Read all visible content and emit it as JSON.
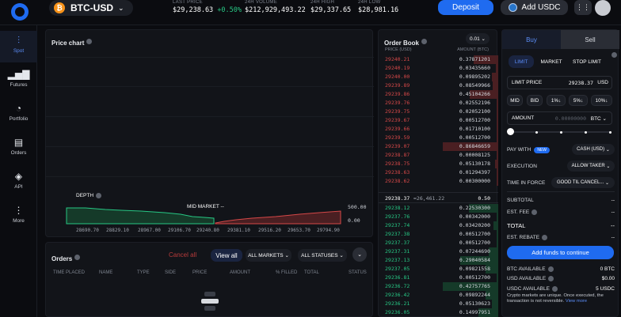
{
  "header": {
    "pair": "BTC-USD",
    "stats": [
      {
        "label": "LAST PRICE",
        "value": "$29,238.63",
        "change": "+0.50%"
      },
      {
        "label": "24H VOLUME",
        "value": "$212,929,493.22"
      },
      {
        "label": "24H HIGH",
        "value": "$29,337.65"
      },
      {
        "label": "24H LOW",
        "value": "$28,981.16"
      }
    ],
    "deposit": "Deposit",
    "add_usdc": "Add USDC"
  },
  "sidebar": [
    {
      "label": "Spot",
      "icon": "chart-icon"
    },
    {
      "label": "Futures",
      "icon": "bar-chart-icon"
    },
    {
      "label": "Portfolio",
      "icon": "pie-chart-icon"
    },
    {
      "label": "Orders",
      "icon": "document-icon"
    },
    {
      "label": "API",
      "icon": "layers-icon"
    },
    {
      "label": "More",
      "icon": "more-icon"
    }
  ],
  "chart": {
    "title": "Price chart",
    "depth_label": "DEPTH",
    "mid_label": "MID MARKET --",
    "y_top": "500.00",
    "y_bottom": "0.00",
    "x_ticks": [
      "28690.70",
      "28829.10",
      "28967.00",
      "29106.70",
      "29240.80",
      "29381.10",
      "29516.20",
      "29653.70",
      "29794.90"
    ]
  },
  "orders": {
    "title": "Orders",
    "cancel_all": "Cancel all",
    "view_all": "View all",
    "markets": "ALL MARKETS",
    "statuses": "ALL STATUSES",
    "columns": [
      "TIME PLACED",
      "NAME",
      "TYPE",
      "SIDE",
      "PRICE",
      "AMOUNT",
      "% FILLED",
      "TOTAL",
      "STATUS"
    ]
  },
  "orderbook": {
    "title": "Order Book",
    "increment": "0.01",
    "col_price": "PRICE (USD)",
    "col_amount": "AMOUNT (BTC)",
    "asks": [
      [
        "29240.21",
        "0.37871201"
      ],
      [
        "29240.19",
        "0.03435660"
      ],
      [
        "29240.00",
        "0.09895202"
      ],
      [
        "29239.89",
        "0.08549966"
      ],
      [
        "29239.86",
        "0.45104266"
      ],
      [
        "29239.76",
        "0.02552196"
      ],
      [
        "29239.75",
        "0.02052100"
      ],
      [
        "29239.67",
        "0.00512700"
      ],
      [
        "29239.66",
        "0.01710100"
      ],
      [
        "29239.59",
        "0.00512700"
      ],
      [
        "29239.07",
        "0.86846659"
      ],
      [
        "29238.87",
        "0.00008125"
      ],
      [
        "29238.75",
        "0.05130178"
      ],
      [
        "29238.63",
        "0.01294397"
      ],
      [
        "29238.62",
        "0.00300000"
      ]
    ],
    "spread_price": "29238.37",
    "spread_usd": "≈26,461.22",
    "spread_val": "0.50",
    "bids": [
      [
        "29238.12",
        "0.22530300"
      ],
      [
        "29237.76",
        "0.00342000"
      ],
      [
        "29237.74",
        "0.03420200"
      ],
      [
        "29237.38",
        "0.00512700"
      ],
      [
        "29237.37",
        "0.00512700"
      ],
      [
        "29237.31",
        "0.07244690"
      ],
      [
        "29237.13",
        "0.29040584"
      ],
      [
        "29237.05",
        "0.09821558"
      ],
      [
        "29236.81",
        "0.00512700"
      ],
      [
        "29236.72",
        "0.42757765"
      ],
      [
        "29236.42",
        "0.09892244"
      ],
      [
        "29236.21",
        "0.05130623"
      ],
      [
        "29236.05",
        "0.14997951"
      ]
    ]
  },
  "trade": {
    "buy": "Buy",
    "sell": "Sell",
    "types": [
      "LIMIT",
      "MARKET",
      "STOP LIMIT"
    ],
    "limit_price_label": "LIMIT PRICE",
    "limit_price": "29238.37",
    "limit_unit": "USD",
    "chips": [
      "MID",
      "BID",
      "1%↓",
      "5%↓",
      "10%↓"
    ],
    "amount_label": "AMOUNT",
    "amount_placeholder": "0.00000000",
    "amount_unit": "BTC",
    "pay_with_label": "PAY WITH",
    "new_badge": "NEW",
    "pay_with": "CASH (USD)",
    "execution_label": "EXECUTION",
    "execution": "ALLOW TAKER",
    "tif_label": "TIME IN FORCE",
    "tif": "GOOD TIL CANCEL...",
    "subtotal": "SUBTOTAL",
    "est_fee": "EST. FEE",
    "total": "TOTAL",
    "rebate": "EST. REBATE",
    "dash": "--",
    "add_funds": "Add funds to continue",
    "balances": [
      {
        "label": "BTC AVAILABLE",
        "value": "0 BTC"
      },
      {
        "label": "USD AVAILABLE",
        "value": "$0.00"
      },
      {
        "label": "USDC AVAILABLE",
        "value": "5 USDC"
      }
    ],
    "note": "Crypto markets are unique. Once executed, the transaction is not reversible.",
    "note_link": "View more"
  }
}
